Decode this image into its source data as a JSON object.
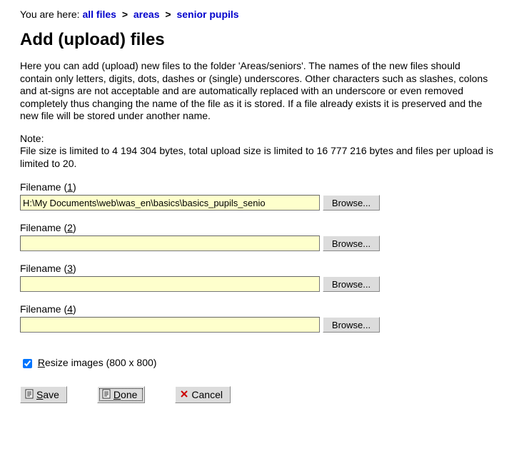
{
  "breadcrumb": {
    "prefix": "You are here: ",
    "items": [
      "all files",
      "areas",
      "senior pupils"
    ]
  },
  "title": "Add (upload) files",
  "intro": {
    "p1": "Here you can add (upload) new files to the folder 'Areas/seniors'. The names of the new files should contain only letters, digits, dots, dashes or (single) underscores. Other characters such as slashes, colons and at-signs are not acceptable and are automatically replaced with an underscore or even removed completely thus changing the name of the file as it is stored. If a file already exists it is preserved and the new file will be stored under another name.",
    "p2": "Note:\nFile size is limited to 4 194 304 bytes, total upload size is limited to 16 777 216 bytes and files per upload is limited to 20."
  },
  "filenames": {
    "label_base": "Filename",
    "browse_label": "Browse...",
    "rows": [
      {
        "num": "1",
        "value": "H:\\My Documents\\web\\was_en\\basics\\basics_pupils_senio"
      },
      {
        "num": "2",
        "value": ""
      },
      {
        "num": "3",
        "value": ""
      },
      {
        "num": "4",
        "value": ""
      }
    ]
  },
  "resize": {
    "checked": true,
    "label_before": "R",
    "label_after": "esize images (800 x 800)"
  },
  "buttons": {
    "save": {
      "mnemonic": "S",
      "rest": "ave"
    },
    "done": {
      "mnemonic": "D",
      "rest": "one"
    },
    "cancel": {
      "mnemonic": "",
      "rest": "Cancel"
    }
  }
}
